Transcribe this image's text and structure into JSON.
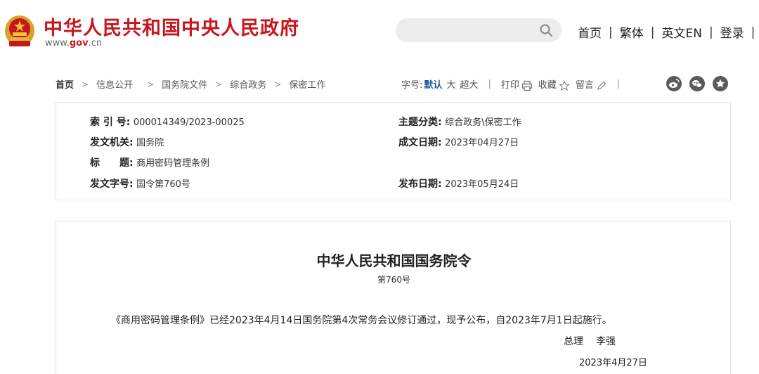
{
  "header": {
    "site_title": "中华人民共和国中央人民政府",
    "domain_prefix": "www.",
    "domain_mid": "gov",
    "domain_suffix": ".cn",
    "nav": [
      "首页",
      "繁体",
      "英文EN",
      "登录"
    ],
    "search_placeholder": ""
  },
  "breadcrumb": {
    "items": [
      "首页",
      "信息公开",
      "国务院文件",
      "综合政务",
      "保密工作"
    ]
  },
  "tools": {
    "font_label": "字号:",
    "font_current": "默认",
    "font_big": "大",
    "font_xbig": "超大",
    "print": "打印",
    "favorite": "收藏",
    "comment": "留言"
  },
  "meta": {
    "index_label": "索 引 号:",
    "index_value": "000014349/2023-00025",
    "category_label": "主题分类:",
    "category_value": "综合政务\\保密工作",
    "issuer_label": "发文机关:",
    "issuer_value": "国务院",
    "written_date_label": "成文日期:",
    "written_date_value": "2023年04月27日",
    "title_label": "标　　题:",
    "title_value": "商用密码管理条例",
    "doc_no_label": "发文字号:",
    "doc_no_value": "国令第760号",
    "publish_date_label": "发布日期:",
    "publish_date_value": "2023年05月24日"
  },
  "document": {
    "title": "中华人民共和国国务院令",
    "number": "第760号",
    "paragraph": "《商用密码管理条例》已经2023年4月14日国务院第4次常务会议修订通过，现予公布，自2023年7月1日起施行。",
    "signer_role": "总理",
    "signer_name": "李强",
    "date": "2023年4月27日"
  },
  "colors": {
    "brand_red": "#c8161d",
    "link_blue": "#1a5fa8",
    "icon_gray": "#5a5a5a"
  }
}
